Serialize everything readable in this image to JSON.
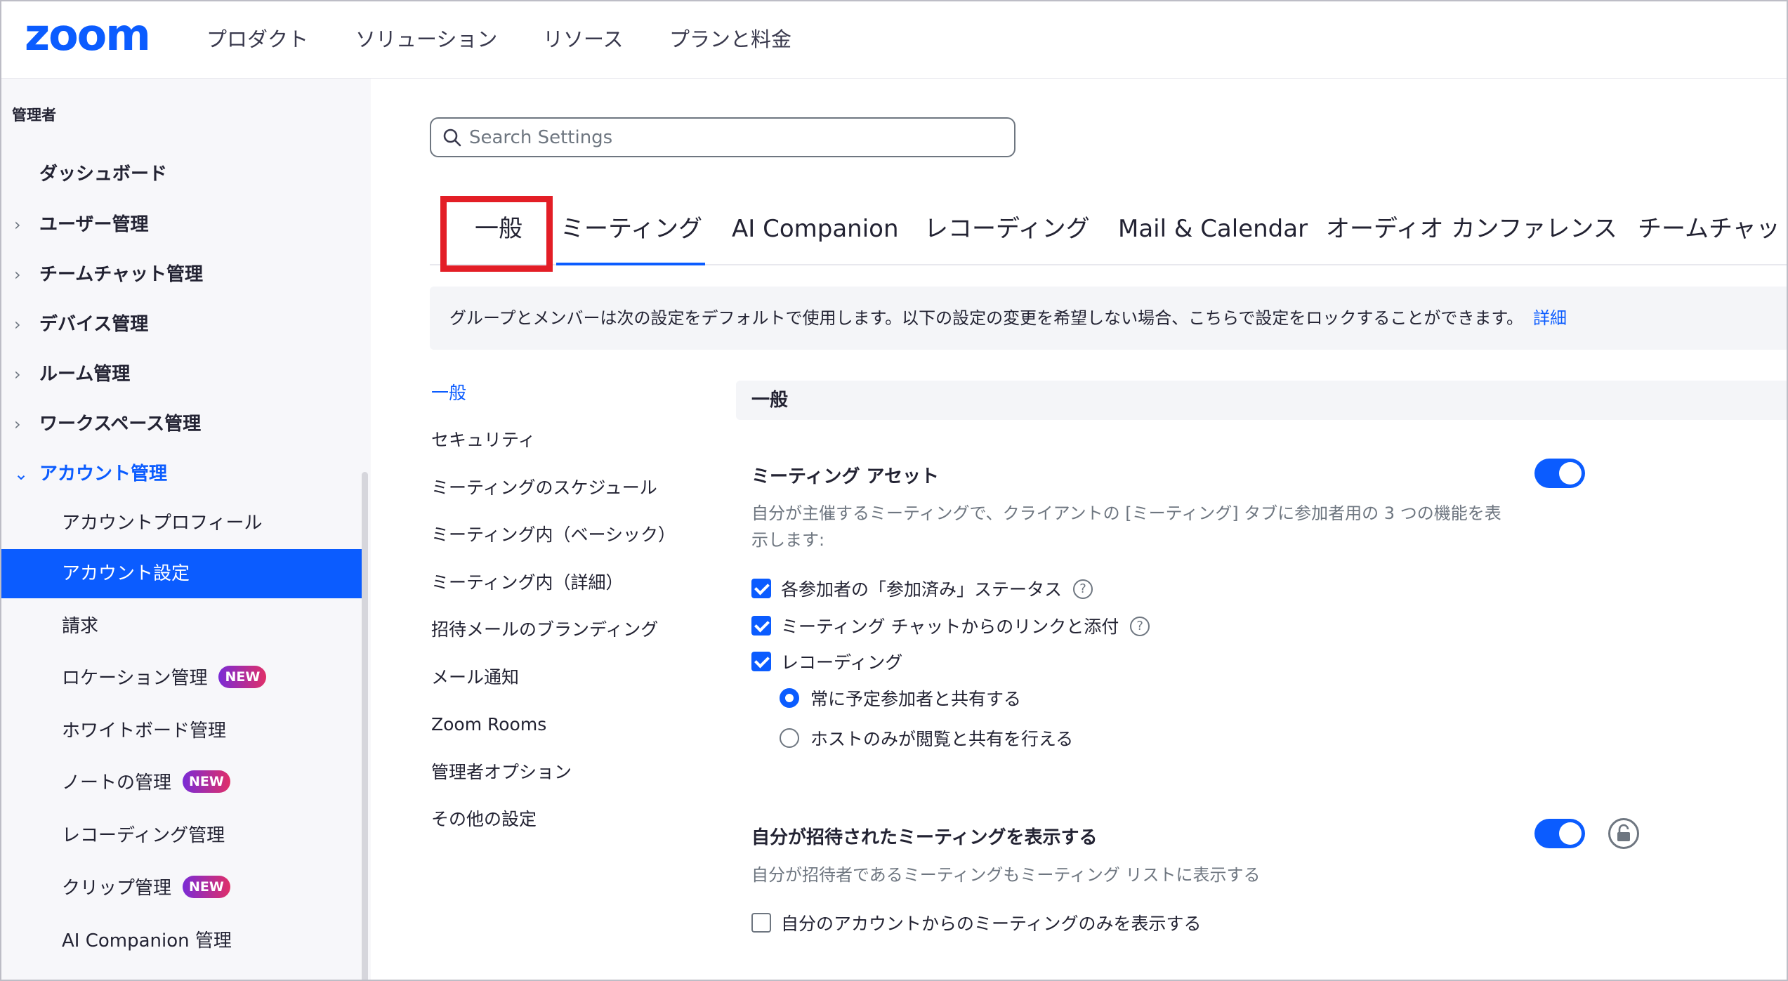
{
  "topnav": {
    "logo": "zoom",
    "items": [
      "プロダクト",
      "ソリューション",
      "リソース",
      "プランと料金"
    ]
  },
  "sidebar": {
    "header": "管理者",
    "items": [
      {
        "label": "ダッシュボード",
        "chevron": ""
      },
      {
        "label": "ユーザー管理",
        "chevron": "›"
      },
      {
        "label": "チームチャット管理",
        "chevron": "›"
      },
      {
        "label": "デバイス管理",
        "chevron": "›"
      },
      {
        "label": "ルーム管理",
        "chevron": "›"
      },
      {
        "label": "ワークスペース管理",
        "chevron": "›"
      },
      {
        "label": "アカウント管理",
        "chevron": "⌄"
      }
    ],
    "subitems": [
      {
        "label": "アカウントプロフィール",
        "badge": ""
      },
      {
        "label": "アカウント設定",
        "badge": ""
      },
      {
        "label": "請求",
        "badge": ""
      },
      {
        "label": "ロケーション管理",
        "badge": "NEW"
      },
      {
        "label": "ホワイトボード管理",
        "badge": ""
      },
      {
        "label": "ノートの管理",
        "badge": "NEW"
      },
      {
        "label": "レコーディング管理",
        "badge": ""
      },
      {
        "label": "クリップ管理",
        "badge": "NEW"
      },
      {
        "label": "AI Companion 管理",
        "badge": ""
      }
    ]
  },
  "search": {
    "placeholder": "Search Settings"
  },
  "tabs": [
    "一般",
    "ミーティング",
    "AI Companion",
    "レコーディング",
    "Mail & Calendar",
    "オーディオ カンファレンス",
    "チームチャット"
  ],
  "notice": {
    "text": "グループとメンバーは次の設定をデフォルトで使用します。以下の設定の変更を希望しない場合、こちらで設定をロックすることができます。",
    "link": "詳細"
  },
  "subnav": [
    "一般",
    "セキュリティ",
    "ミーティングのスケジュール",
    "ミーティング内（ベーシック）",
    "ミーティング内（詳細）",
    "招待メールのブランディング",
    "メール通知",
    "Zoom Rooms",
    "管理者オプション",
    "その他の設定"
  ],
  "section": {
    "title": "一般"
  },
  "setting1": {
    "title": "ミーティング アセット",
    "desc": "自分が主催するミーティングで、クライアントの [ミーティング] タブに参加者用の 3 つの機能を表示します:",
    "checks": [
      "各参加者の「参加済み」ステータス",
      "ミーティング チャットからのリンクと添付",
      "レコーディング"
    ],
    "radios": [
      "常に予定参加者と共有する",
      "ホストのみが閲覧と共有を行える"
    ]
  },
  "setting2": {
    "title": "自分が招待されたミーティングを表示する",
    "desc": "自分が招待者であるミーティングもミーティング リストに表示する",
    "check": "自分のアカウントからのミーティングのみを表示する"
  },
  "colors": {
    "accent": "#0b5cff",
    "highlight": "#e31e26"
  }
}
